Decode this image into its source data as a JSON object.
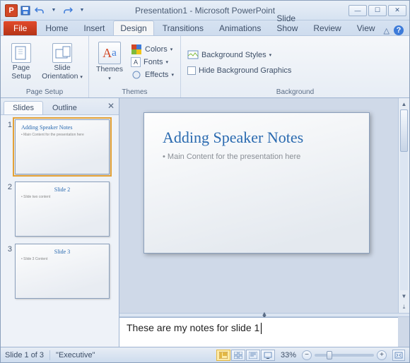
{
  "window": {
    "title": "Presentation1 - Microsoft PowerPoint",
    "app_letter": "P"
  },
  "ribbon": {
    "file_label": "File",
    "tabs": [
      "Home",
      "Insert",
      "Design",
      "Transitions",
      "Animations",
      "Slide Show",
      "Review",
      "View"
    ],
    "active_tab": "Design",
    "groups": {
      "page_setup": {
        "label": "Page Setup",
        "page_setup_btn": "Page\nSetup",
        "orientation_btn": "Slide\nOrientation"
      },
      "themes": {
        "label": "Themes",
        "themes_btn": "Themes",
        "colors": "Colors",
        "fonts": "Fonts",
        "effects": "Effects"
      },
      "background": {
        "label": "Background",
        "styles": "Background Styles",
        "hide": "Hide Background Graphics"
      }
    }
  },
  "sidepanel": {
    "tabs": {
      "slides": "Slides",
      "outline": "Outline"
    },
    "thumbs": [
      {
        "num": "1",
        "title": "Adding Speaker Notes",
        "content": "Main Content for the presentation here",
        "selected": true,
        "layout": "title"
      },
      {
        "num": "2",
        "title": "Slide 2",
        "content": "Slide two content",
        "selected": false,
        "layout": "content"
      },
      {
        "num": "3",
        "title": "Slide 3",
        "content": "Slide 3 Content",
        "selected": false,
        "layout": "content"
      }
    ]
  },
  "slide": {
    "title": "Adding Speaker Notes",
    "content": "Main Content for the presentation here"
  },
  "notes": {
    "text": "These are my notes for slide 1"
  },
  "statusbar": {
    "slide_info": "Slide 1 of 3",
    "theme": "\"Executive\"",
    "zoom": "33%"
  }
}
